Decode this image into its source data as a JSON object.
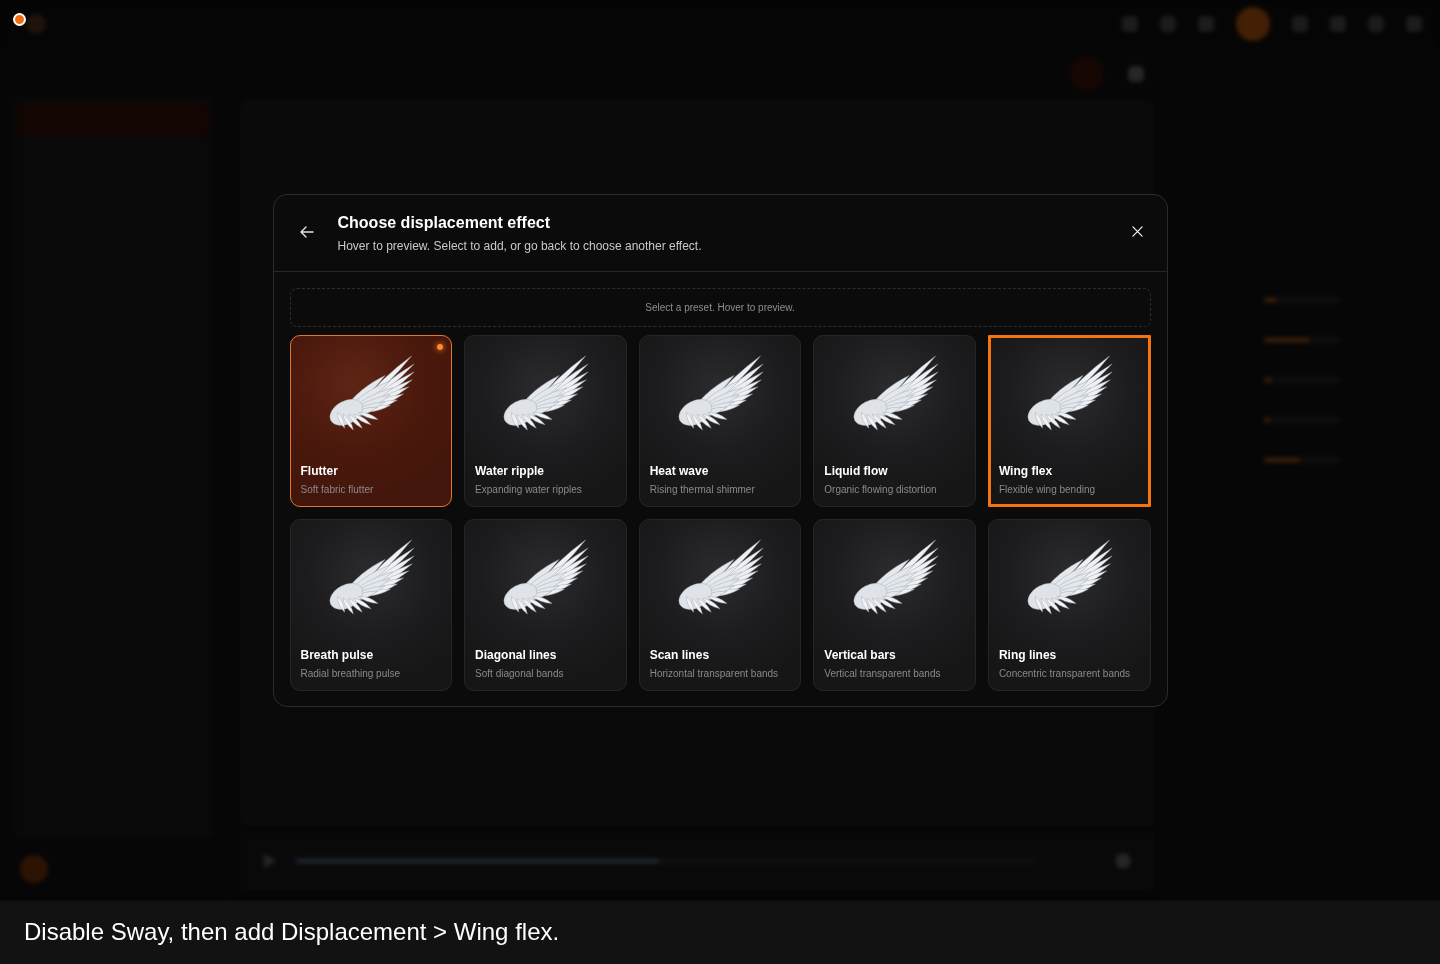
{
  "background": {
    "playback": {
      "level": 0.49
    },
    "inspector_sliders": [
      {
        "level": 0.17
      },
      {
        "level": 0.6
      },
      {
        "level": 0.1
      },
      {
        "level": 0.08
      },
      {
        "level": 0.48
      }
    ]
  },
  "dialog": {
    "title": "Choose displacement effect",
    "subtitle": "Hover to preview. Select to add, or go back to choose another effect.",
    "hint": "Select a preset. Hover to preview.",
    "presets": [
      {
        "name": "Flutter",
        "description": "Soft fabric flutter",
        "selected": true,
        "highlighted": false
      },
      {
        "name": "Water ripple",
        "description": "Expanding water ripples",
        "selected": false,
        "highlighted": false
      },
      {
        "name": "Heat wave",
        "description": "Rising thermal shimmer",
        "selected": false,
        "highlighted": false
      },
      {
        "name": "Liquid flow",
        "description": "Organic flowing distortion",
        "selected": false,
        "highlighted": false
      },
      {
        "name": "Wing flex",
        "description": "Flexible wing bending",
        "selected": false,
        "highlighted": true
      },
      {
        "name": "Breath pulse",
        "description": "Radial breathing pulse",
        "selected": false,
        "highlighted": false
      },
      {
        "name": "Diagonal lines",
        "description": "Soft diagonal bands",
        "selected": false,
        "highlighted": false
      },
      {
        "name": "Scan lines",
        "description": "Horizontal transparent bands",
        "selected": false,
        "highlighted": false
      },
      {
        "name": "Vertical bars",
        "description": "Vertical transparent bands",
        "selected": false,
        "highlighted": false
      },
      {
        "name": "Ring lines",
        "description": "Concentric transparent bands",
        "selected": false,
        "highlighted": false
      }
    ]
  },
  "caption": "Disable Sway, then add Displacement > Wing flex."
}
